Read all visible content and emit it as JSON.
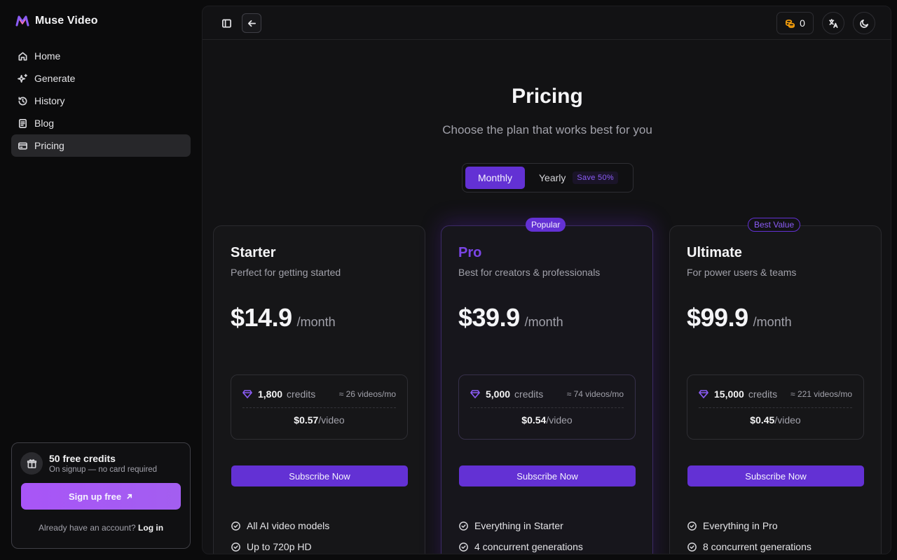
{
  "app": {
    "name": "Muse Video"
  },
  "sidebar": {
    "items": [
      {
        "label": "Home",
        "icon": "home-icon"
      },
      {
        "label": "Generate",
        "icon": "sparkles-icon"
      },
      {
        "label": "History",
        "icon": "history-icon"
      },
      {
        "label": "Blog",
        "icon": "document-icon"
      },
      {
        "label": "Pricing",
        "icon": "wallet-icon",
        "active": true
      }
    ]
  },
  "promo": {
    "title": "50 free credits",
    "subtitle": "On signup — no card required",
    "button": "Sign up free",
    "login_prompt": "Already have an account?",
    "login_link": "Log in"
  },
  "topbar": {
    "credits": "0"
  },
  "page": {
    "title": "Pricing",
    "subtitle": "Choose the plan that works best for you",
    "billing": {
      "monthly": "Monthly",
      "yearly": "Yearly",
      "save_badge": "Save 50%",
      "selected": "Monthly"
    }
  },
  "plans": [
    {
      "name": "Starter",
      "description": "Perfect for getting started",
      "price": "$14.9",
      "period": "/month",
      "credits": "1,800",
      "credits_unit": "credits",
      "videos": "≈ 26 videos/mo",
      "per_video": "$0.57",
      "per_video_unit": "/video",
      "button": "Subscribe Now",
      "features": [
        "All AI video models",
        "Up to 720p HD"
      ]
    },
    {
      "name": "Pro",
      "badge": "Popular",
      "description": "Best for creators & professionals",
      "price": "$39.9",
      "period": "/month",
      "credits": "5,000",
      "credits_unit": "credits",
      "videos": "≈ 74 videos/mo",
      "per_video": "$0.54",
      "per_video_unit": "/video",
      "button": "Subscribe Now",
      "features": [
        "Everything in Starter",
        "4 concurrent generations"
      ]
    },
    {
      "name": "Ultimate",
      "badge": "Best Value",
      "description": "For power users & teams",
      "price": "$99.9",
      "period": "/month",
      "credits": "15,000",
      "credits_unit": "credits",
      "videos": "≈ 221 videos/mo",
      "per_video": "$0.45",
      "per_video_unit": "/video",
      "button": "Subscribe Now",
      "features": [
        "Everything in Pro",
        "8 concurrent generations"
      ]
    }
  ],
  "colors": {
    "accent": "#6331d4",
    "accent_light": "#8b5cf6",
    "promo_button": "#a855f7",
    "credits_icon": "#f59e0b"
  }
}
